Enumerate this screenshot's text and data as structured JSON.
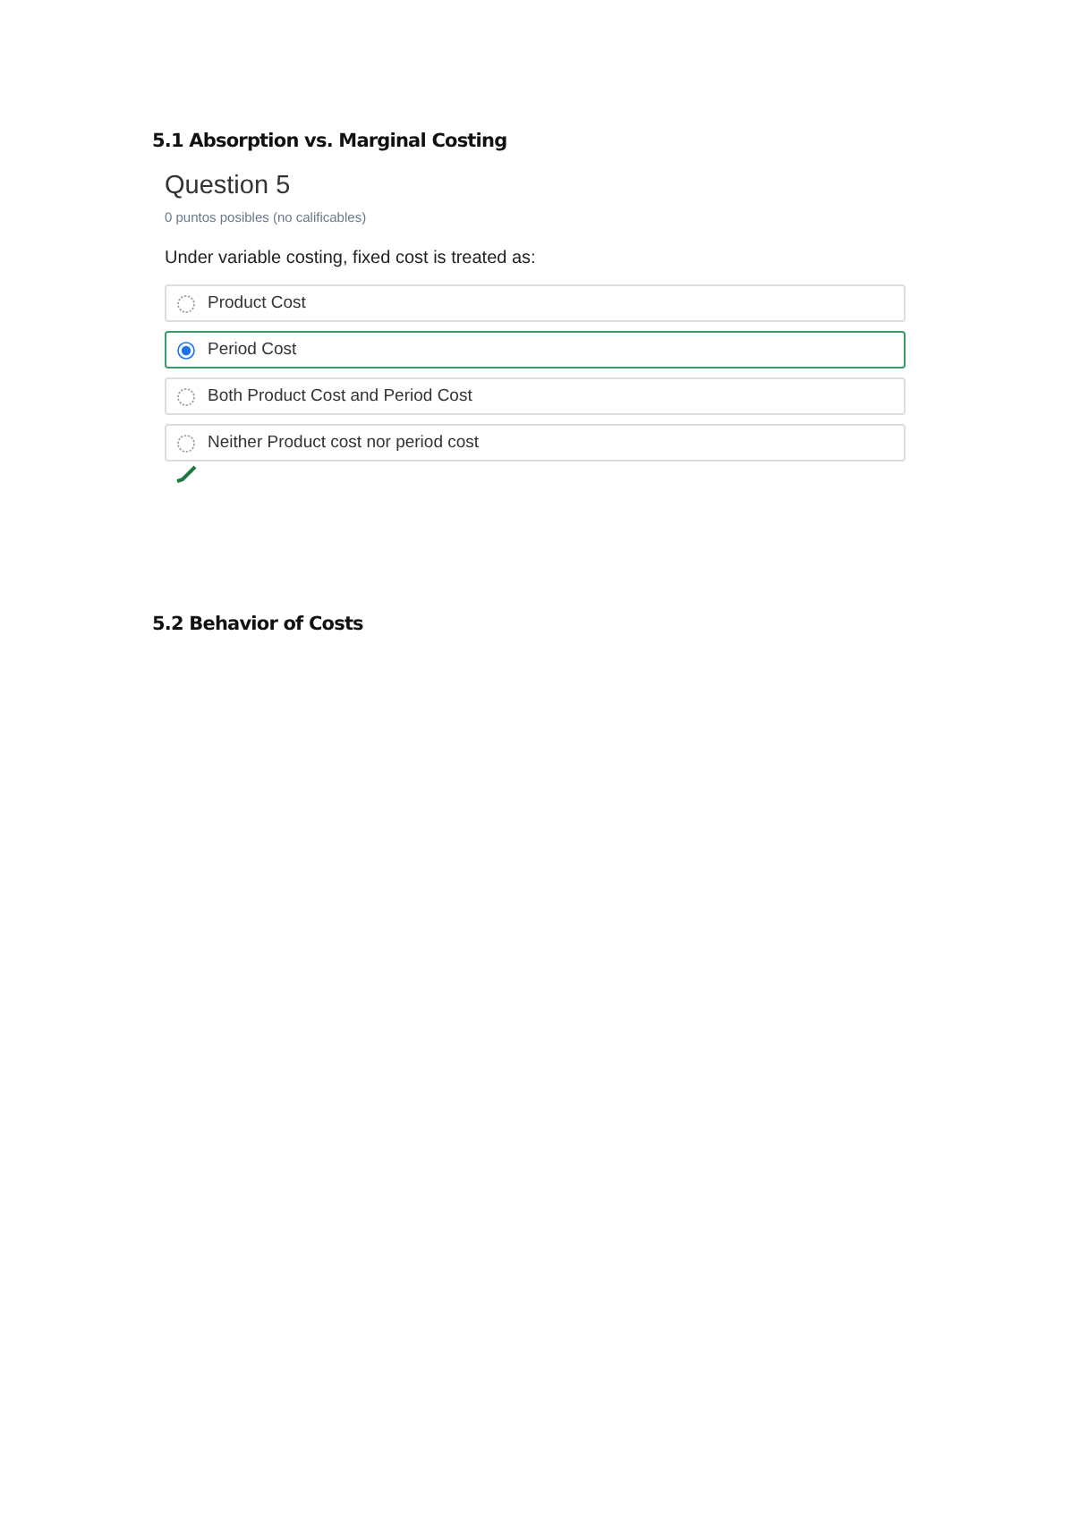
{
  "sections": [
    {
      "heading": "5.1 Absorption vs. Marginal Costing"
    },
    {
      "heading": "5.2 Behavior of Costs"
    }
  ],
  "question": {
    "title": "Question 5",
    "points": "0 puntos posibles (no calificables)",
    "prompt": "Under variable costing, fixed cost is treated as:",
    "options": [
      {
        "label": "Product Cost",
        "selected": false
      },
      {
        "label": "Period Cost",
        "selected": true
      },
      {
        "label": "Both Product Cost and Period Cost",
        "selected": false
      },
      {
        "label": "Neither Product cost nor period cost",
        "selected": false
      }
    ],
    "answer_correct": true
  }
}
